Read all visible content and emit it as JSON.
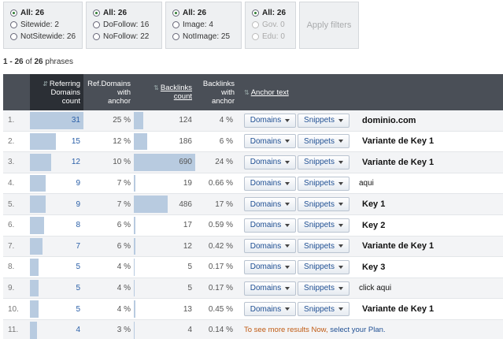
{
  "filters": {
    "groups": [
      {
        "options": [
          {
            "label": "All: 26",
            "selected": true
          },
          {
            "label": "Sitewide: 2",
            "selected": false
          },
          {
            "label": "NotSitewide: 26",
            "selected": false
          }
        ]
      },
      {
        "options": [
          {
            "label": "All: 26",
            "selected": true
          },
          {
            "label": "DoFollow: 16",
            "selected": false
          },
          {
            "label": "NoFollow: 22",
            "selected": false
          }
        ]
      },
      {
        "options": [
          {
            "label": "All: 26",
            "selected": true
          },
          {
            "label": "Image: 4",
            "selected": false
          },
          {
            "label": "NotImage: 25",
            "selected": false
          }
        ]
      },
      {
        "options": [
          {
            "label": "All: 26",
            "selected": true
          },
          {
            "label": "Gov. 0",
            "selected": false
          },
          {
            "label": "Edu: 0",
            "selected": false
          }
        ]
      }
    ],
    "apply_label": "Apply filters"
  },
  "summary": {
    "range": "1 - 26",
    "of": "of",
    "total": "26",
    "unit": "phrases"
  },
  "table": {
    "headers": {
      "ref_domains": [
        "Referring",
        "Domains",
        "count"
      ],
      "ref_domains_anchor": [
        "Ref.Domains",
        "with",
        "anchor"
      ],
      "backlinks": [
        "Backlinks",
        "count"
      ],
      "backlinks_anchor": [
        "Backlinks",
        "with",
        "anchor"
      ],
      "anchor_text": "Anchor text"
    },
    "domains_label": "Domains",
    "snippets_label": "Snippets",
    "rows": [
      {
        "idx": "1.",
        "ref": "31",
        "ref_bar": 1.0,
        "refa": "25 %",
        "refa_bar": 0.0,
        "bl": "124",
        "bl_bar": 0.15,
        "bla": "4 %",
        "anchor": "dominio.com",
        "bold": true
      },
      {
        "idx": "2.",
        "ref": "15",
        "ref_bar": 0.48,
        "refa": "12 %",
        "refa_bar": 0.0,
        "bl": "186",
        "bl_bar": 0.22,
        "bla": "6 %",
        "anchor": "Variante de Key 1",
        "bold": true
      },
      {
        "idx": "3.",
        "ref": "12",
        "ref_bar": 0.39,
        "refa": "10 %",
        "refa_bar": 0.0,
        "bl": "690",
        "bl_bar": 1.0,
        "bla": "24 %",
        "anchor": "Variante de Key 1",
        "bold": true
      },
      {
        "idx": "4.",
        "ref": "9",
        "ref_bar": 0.29,
        "refa": "7 %",
        "refa_bar": 0.0,
        "bl": "19",
        "bl_bar": 0.02,
        "bla": "0.66 %",
        "anchor": "aqui",
        "bold": false
      },
      {
        "idx": "5.",
        "ref": "9",
        "ref_bar": 0.29,
        "refa": "7 %",
        "refa_bar": 0.0,
        "bl": "486",
        "bl_bar": 0.55,
        "bla": "17 %",
        "anchor": "Key 1",
        "bold": true
      },
      {
        "idx": "6.",
        "ref": "8",
        "ref_bar": 0.26,
        "refa": "6 %",
        "refa_bar": 0.0,
        "bl": "17",
        "bl_bar": 0.02,
        "bla": "0.59 %",
        "anchor": "Key 2",
        "bold": true
      },
      {
        "idx": "7.",
        "ref": "7",
        "ref_bar": 0.23,
        "refa": "6 %",
        "refa_bar": 0.0,
        "bl": "12",
        "bl_bar": 0.02,
        "bla": "0.42 %",
        "anchor": "Variante de Key 1",
        "bold": true
      },
      {
        "idx": "8.",
        "ref": "5",
        "ref_bar": 0.16,
        "refa": "4 %",
        "refa_bar": 0.0,
        "bl": "5",
        "bl_bar": 0.01,
        "bla": "0.17 %",
        "anchor": "Key 3",
        "bold": true
      },
      {
        "idx": "9.",
        "ref": "5",
        "ref_bar": 0.16,
        "refa": "4 %",
        "refa_bar": 0.0,
        "bl": "5",
        "bl_bar": 0.01,
        "bla": "0.17 %",
        "anchor": "click aqui",
        "bold": false
      },
      {
        "idx": "10.",
        "ref": "5",
        "ref_bar": 0.16,
        "refa": "4 %",
        "refa_bar": 0.0,
        "bl": "13",
        "bl_bar": 0.02,
        "bla": "0.45 %",
        "anchor": "Variante de Key 1",
        "bold": true
      },
      {
        "idx": "11.",
        "ref": "4",
        "ref_bar": 0.13,
        "refa": "3 %",
        "refa_bar": 0.0,
        "bl": "4",
        "bl_bar": 0.01,
        "bla": "0.14 %",
        "anchor": "",
        "bold": false
      }
    ],
    "upsell": {
      "text": "To see more results Now, ",
      "link": "select your Plan."
    }
  },
  "colors": {
    "header_bg": "#4a4f57",
    "header_sorted_bg": "#2b2f35",
    "bar": "#b8cbe0",
    "link": "#1f4f93",
    "upsell": "#c05a12"
  }
}
